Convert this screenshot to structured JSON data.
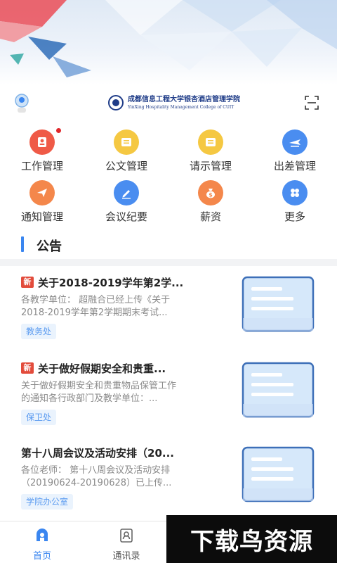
{
  "header": {
    "logo_cn": "成都信息工程大学银杏酒店管理学院",
    "logo_en": "YinXing Hospitality Management College of CUIT"
  },
  "grid": [
    {
      "label": "工作管理",
      "color": "#ef5a47",
      "icon": "user-badge-icon",
      "badge": true
    },
    {
      "label": "公文管理",
      "color": "#f5c842",
      "icon": "document-icon",
      "badge": false
    },
    {
      "label": "请示管理",
      "color": "#f5c842",
      "icon": "document-icon",
      "badge": false
    },
    {
      "label": "出差管理",
      "color": "#4a8df0",
      "icon": "airplane-icon",
      "badge": false
    },
    {
      "label": "通知管理",
      "color": "#f4874b",
      "icon": "paper-plane-icon",
      "badge": false
    },
    {
      "label": "会议纪要",
      "color": "#4a8df0",
      "icon": "pen-icon",
      "badge": false
    },
    {
      "label": "薪资",
      "color": "#f4874b",
      "icon": "money-bag-icon",
      "badge": false
    },
    {
      "label": "更多",
      "color": "#4a8df0",
      "icon": "more-grid-icon",
      "badge": false
    }
  ],
  "notice": {
    "title": "公告",
    "new_label": "新",
    "items": [
      {
        "is_new": true,
        "title": "关于2018-2019学年第2学...",
        "body": "各教学单位： 超融合已经上传《关于2018-2019学年第2学期期末考试...",
        "tag": "教务处"
      },
      {
        "is_new": true,
        "title": "关于做好假期安全和贵重...",
        "body": "关于做好假期安全和贵重物品保管工作的通知各行政部门及教学单位：...",
        "tag": "保卫处"
      },
      {
        "is_new": false,
        "title": "第十八周会议及活动安排（20...",
        "body": "各位老师： 第十八周会议及活动安排（20190624-20190628）已上传...",
        "tag": "学院办公室"
      }
    ]
  },
  "tabbar": {
    "items": [
      {
        "label": "首页",
        "icon": "home-icon",
        "active": true
      },
      {
        "label": "通讯录",
        "icon": "contacts-icon",
        "active": false
      }
    ]
  },
  "watermark": "下载鸟资源",
  "colors": {
    "accent": "#3a86f0"
  }
}
